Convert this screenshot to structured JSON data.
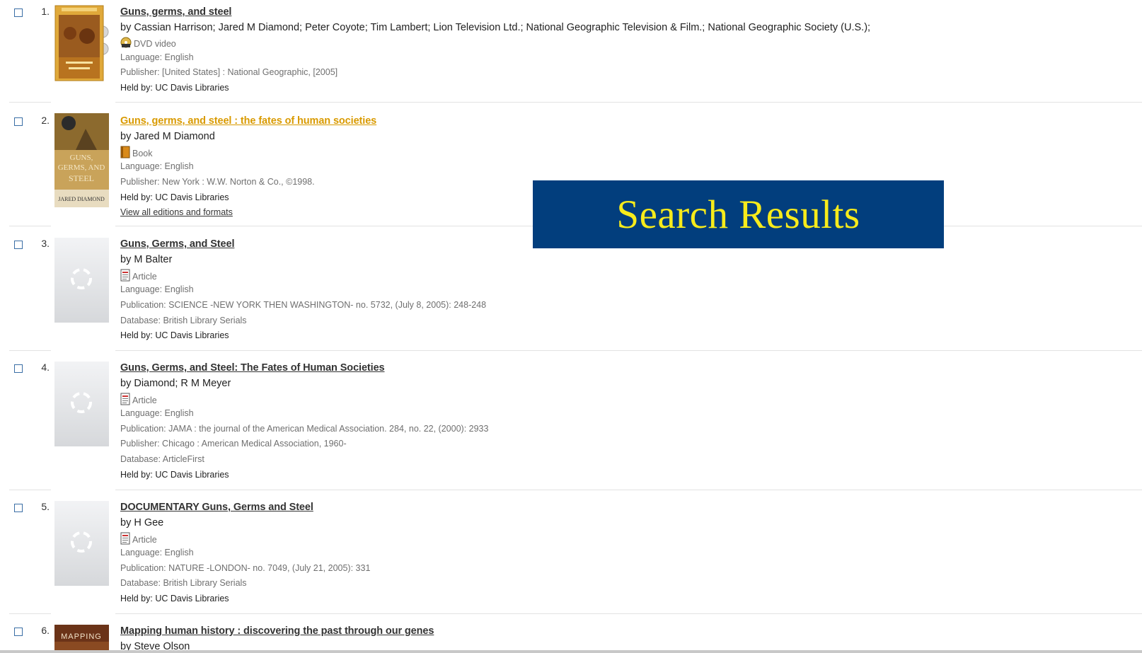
{
  "banner": {
    "text": "Search Results"
  },
  "results": [
    {
      "number": "1.",
      "title": "Guns, germs, and steel",
      "authors": "by Cassian Harrison; Jared M Diamond; Peter Coyote; Tim Lambert; Lion Television Ltd.; National Geographic Television & Film.; National Geographic Society (U.S.);",
      "format": "DVD video",
      "format_icon": "dvd-icon",
      "language": "Language: English",
      "publisher": "Publisher: [United States] : National Geographic, [2005]",
      "held_by": "Held by: UC Davis Libraries"
    },
    {
      "number": "2.",
      "title": "Guns, germs, and steel : the fates of human societies",
      "authors": "by Jared M Diamond",
      "format": "Book",
      "format_icon": "book-icon",
      "language": "Language: English",
      "publisher": "Publisher: New York : W.W. Norton & Co., ©1998.",
      "held_by": "Held by: UC Davis Libraries",
      "editions_link": "View all editions and formats",
      "cover_title": "GUNS, GERMS, AND STEEL",
      "cover_author": "JARED DIAMOND"
    },
    {
      "number": "3.",
      "title": "Guns, Germs, and Steel",
      "authors": "by M Balter",
      "format": "Article",
      "format_icon": "article-icon",
      "language": "Language: English",
      "publication": "Publication: SCIENCE -NEW YORK THEN WASHINGTON- no. 5732, (July 8, 2005): 248-248",
      "database": "Database: British Library Serials",
      "held_by": "Held by: UC Davis Libraries"
    },
    {
      "number": "4.",
      "title": "Guns, Germs, and Steel: The Fates of Human Societies",
      "authors": "by Diamond; R M Meyer",
      "format": "Article",
      "format_icon": "article-icon",
      "language": "Language: English",
      "publication": "Publication: JAMA : the journal of the American Medical Association. 284, no. 22, (2000): 2933",
      "publisher": "Publisher: Chicago : American Medical Association, 1960-",
      "database": "Database: ArticleFirst",
      "held_by": "Held by: UC Davis Libraries"
    },
    {
      "number": "5.",
      "title": "DOCUMENTARY Guns, Germs and Steel",
      "authors": "by H Gee",
      "format": "Article",
      "format_icon": "article-icon",
      "language": "Language: English",
      "publication": "Publication: NATURE -LONDON- no. 7049, (July 21, 2005): 331",
      "database": "Database: British Library Serials",
      "held_by": "Held by: UC Davis Libraries"
    },
    {
      "number": "6.",
      "title": "Mapping human history : discovering the past through our genes",
      "authors": "by Steve Olson",
      "cover_title": "MAPPING"
    }
  ]
}
